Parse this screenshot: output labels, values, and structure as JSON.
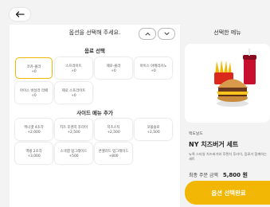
{
  "header": {
    "back_icon": "arrow-left-icon"
  },
  "options": {
    "title": "옵션을 선택해 주세요.",
    "sauce_title": "음료 선택",
    "sauce_items": [
      {
        "name": "코카-콜라",
        "price": "+0"
      },
      {
        "name": "스프라이트",
        "price": "+0"
      },
      {
        "name": "제로-콜라",
        "price": "+0"
      },
      {
        "name": "아이스 아메리카노",
        "price": "+0"
      },
      {
        "name": "아이스 바닐라 라떼",
        "price": "+0"
      },
      {
        "name": "제로 스프라이트",
        "price": "+0"
      }
    ],
    "side_title": "사이드 메뉴 추가",
    "side_items": [
      {
        "name": "맥너겟 4조각",
        "price": "+2,000"
      },
      {
        "name": "치즈 후렌치 후라이",
        "price": "+2,500"
      },
      {
        "name": "치즈스틱",
        "price": "+2,500"
      },
      {
        "name": "코울슬로",
        "price": "+2,500"
      },
      {
        "name": "맥윙 2조각",
        "price": "+3,000"
      },
      {
        "name": "스낵랩 업그레이드",
        "price": "+500"
      },
      {
        "name": "콘샐러드 업그레이드",
        "price": "+800"
      }
    ]
  },
  "summary": {
    "title": "선택한 메뉴",
    "brand": "맥도날드",
    "product_name": "NY 치즈버거 세트",
    "description": "뉴욕 스타일 치즈버거와 후렌치 후라이, 음료가 함께하는 세트",
    "total_label": "최종 주문 금액",
    "total_value": "5,800 원",
    "confirm_label": "옵션 선택완료"
  }
}
